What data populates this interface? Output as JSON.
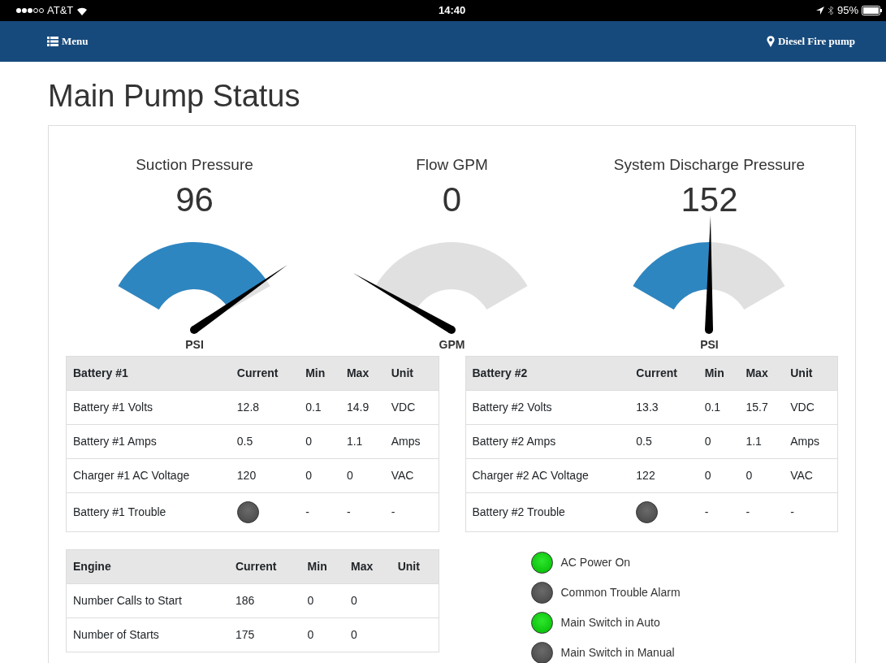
{
  "status_bar": {
    "carrier": "AT&T",
    "time": "14:40",
    "battery": "95%"
  },
  "navbar": {
    "menu": "Menu",
    "location": "Diesel Fire pump"
  },
  "title": "Main Pump Status",
  "gauges": [
    {
      "title": "Suction Pressure",
      "value": "96",
      "unit": "PSI"
    },
    {
      "title": "Flow GPM",
      "value": "0",
      "unit": "GPM"
    },
    {
      "title": "System Discharge Pressure",
      "value": "152",
      "unit": "PSI"
    }
  ],
  "battery_tables": [
    {
      "columns": [
        "Battery #1",
        "Current",
        "Min",
        "Max",
        "Unit"
      ],
      "rows": [
        {
          "cells": [
            "Battery #1 Volts",
            "12.8",
            "0.1",
            "14.9",
            "VDC"
          ]
        },
        {
          "cells": [
            "Battery #1 Amps",
            "0.5",
            "0",
            "1.1",
            "Amps"
          ]
        },
        {
          "cells": [
            "Charger #1 AC Voltage",
            "120",
            "0",
            "0",
            "VAC"
          ]
        },
        {
          "cells": [
            "Battery #1 Trouble",
            {
              "kind": "light",
              "on": false
            },
            "-",
            "-",
            "-"
          ]
        }
      ]
    },
    {
      "columns": [
        "Battery #2",
        "Current",
        "Min",
        "Max",
        "Unit"
      ],
      "rows": [
        {
          "cells": [
            "Battery #2 Volts",
            "13.3",
            "0.1",
            "15.7",
            "VDC"
          ]
        },
        {
          "cells": [
            "Battery #2 Amps",
            "0.5",
            "0",
            "1.1",
            "Amps"
          ]
        },
        {
          "cells": [
            "Charger #2 AC Voltage",
            "122",
            "0",
            "0",
            "VAC"
          ]
        },
        {
          "cells": [
            "Battery #2 Trouble",
            {
              "kind": "light",
              "on": false
            },
            "-",
            "-",
            "-"
          ]
        }
      ]
    }
  ],
  "engine_table": {
    "columns": [
      "Engine",
      "Current",
      "Min",
      "Max",
      "Unit"
    ],
    "rows": [
      {
        "cells": [
          "Number Calls to Start",
          "186",
          "0",
          "0"
        ]
      },
      {
        "cells": [
          "Number of Starts",
          "175",
          "0",
          "0"
        ]
      }
    ]
  },
  "indicators": [
    {
      "label": "AC Power On",
      "on": true
    },
    {
      "label": "Common Trouble Alarm",
      "on": false
    },
    {
      "label": "Main Switch in Auto",
      "on": true
    },
    {
      "label": "Main Switch in Manual",
      "on": false
    }
  ]
}
